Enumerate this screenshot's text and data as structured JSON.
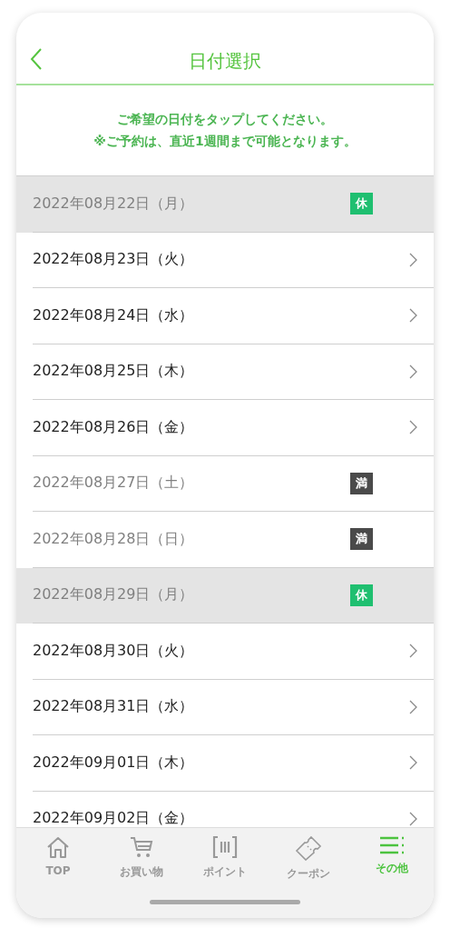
{
  "header": {
    "title": "日付選択"
  },
  "notice": [
    "ご希望の日付をタップしてください。",
    "※ご予約は、直近1週間まで可能となります。"
  ],
  "dates": [
    {
      "label": "2022年08月22日（月）",
      "kind": "closed",
      "badge": "休"
    },
    {
      "label": "2022年08月23日（火）",
      "kind": "open"
    },
    {
      "label": "2022年08月24日（水）",
      "kind": "open"
    },
    {
      "label": "2022年08月25日（木）",
      "kind": "open"
    },
    {
      "label": "2022年08月26日（金）",
      "kind": "open"
    },
    {
      "label": "2022年08月27日（土）",
      "kind": "full",
      "badge": "満"
    },
    {
      "label": "2022年08月28日（日）",
      "kind": "full",
      "badge": "満"
    },
    {
      "label": "2022年08月29日（月）",
      "kind": "closed",
      "badge": "休"
    },
    {
      "label": "2022年08月30日（火）",
      "kind": "open"
    },
    {
      "label": "2022年08月31日（水）",
      "kind": "open"
    },
    {
      "label": "2022年09月01日（木）",
      "kind": "open"
    },
    {
      "label": "2022年09月02日（金）",
      "kind": "open"
    }
  ],
  "tab_bar": [
    {
      "label": "TOP",
      "selected": false
    },
    {
      "label": "お買い物",
      "selected": false
    },
    {
      "label": "ポイント",
      "selected": false
    },
    {
      "label": "クーポン",
      "selected": false
    },
    {
      "label": "その他",
      "selected": true
    }
  ]
}
